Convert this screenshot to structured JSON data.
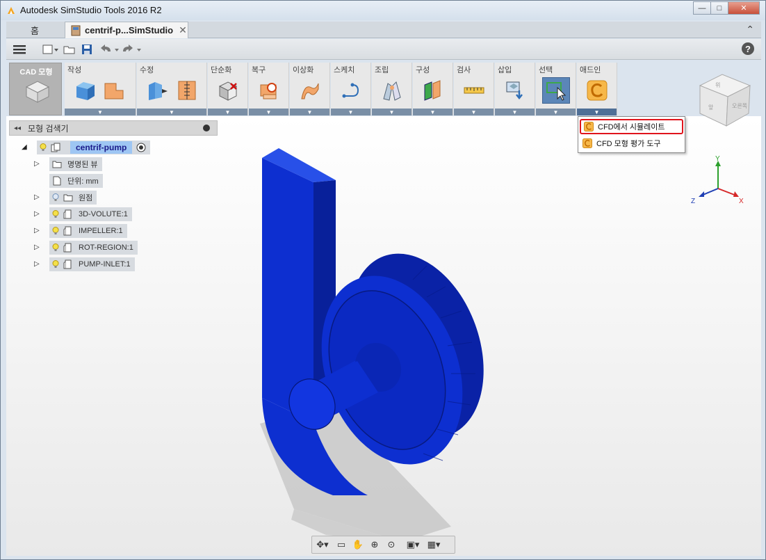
{
  "window": {
    "title": "Autodesk SimStudio Tools 2016 R2",
    "buttons": {
      "minimize": "—",
      "maximize": "□",
      "close": "✕"
    }
  },
  "tabs": {
    "home": "홈",
    "doc": "centrif-p...SimStudio",
    "doc_close": "✕"
  },
  "ribbon": {
    "workspace": "CAD 모형",
    "panels": [
      "작성",
      "수정",
      "단순화",
      "복구",
      "이상화",
      "스케치",
      "조립",
      "구성",
      "검사",
      "삽입",
      "선택",
      "애드인"
    ]
  },
  "browser": {
    "title": "모형 검색기",
    "root": "centrif-pump",
    "items": [
      "명명된 뷰",
      "단위: mm",
      "원점",
      "3D-VOLUTE:1",
      "IMPELLER:1",
      "ROT-REGION:1",
      "PUMP-INLET:1"
    ]
  },
  "menu": {
    "items": [
      "CFD에서 시뮬레이트",
      "CFD 모형 평가 도구"
    ]
  },
  "viewcube": {
    "faces": [
      "위",
      "앞",
      "오른쪽"
    ]
  },
  "axes": {
    "x": "X",
    "y": "Y",
    "z": "Z"
  },
  "colors": {
    "model_blue": "#0a2dc8",
    "accent_red": "#e0141c",
    "ribbon_drop": "#7a8fa6"
  }
}
